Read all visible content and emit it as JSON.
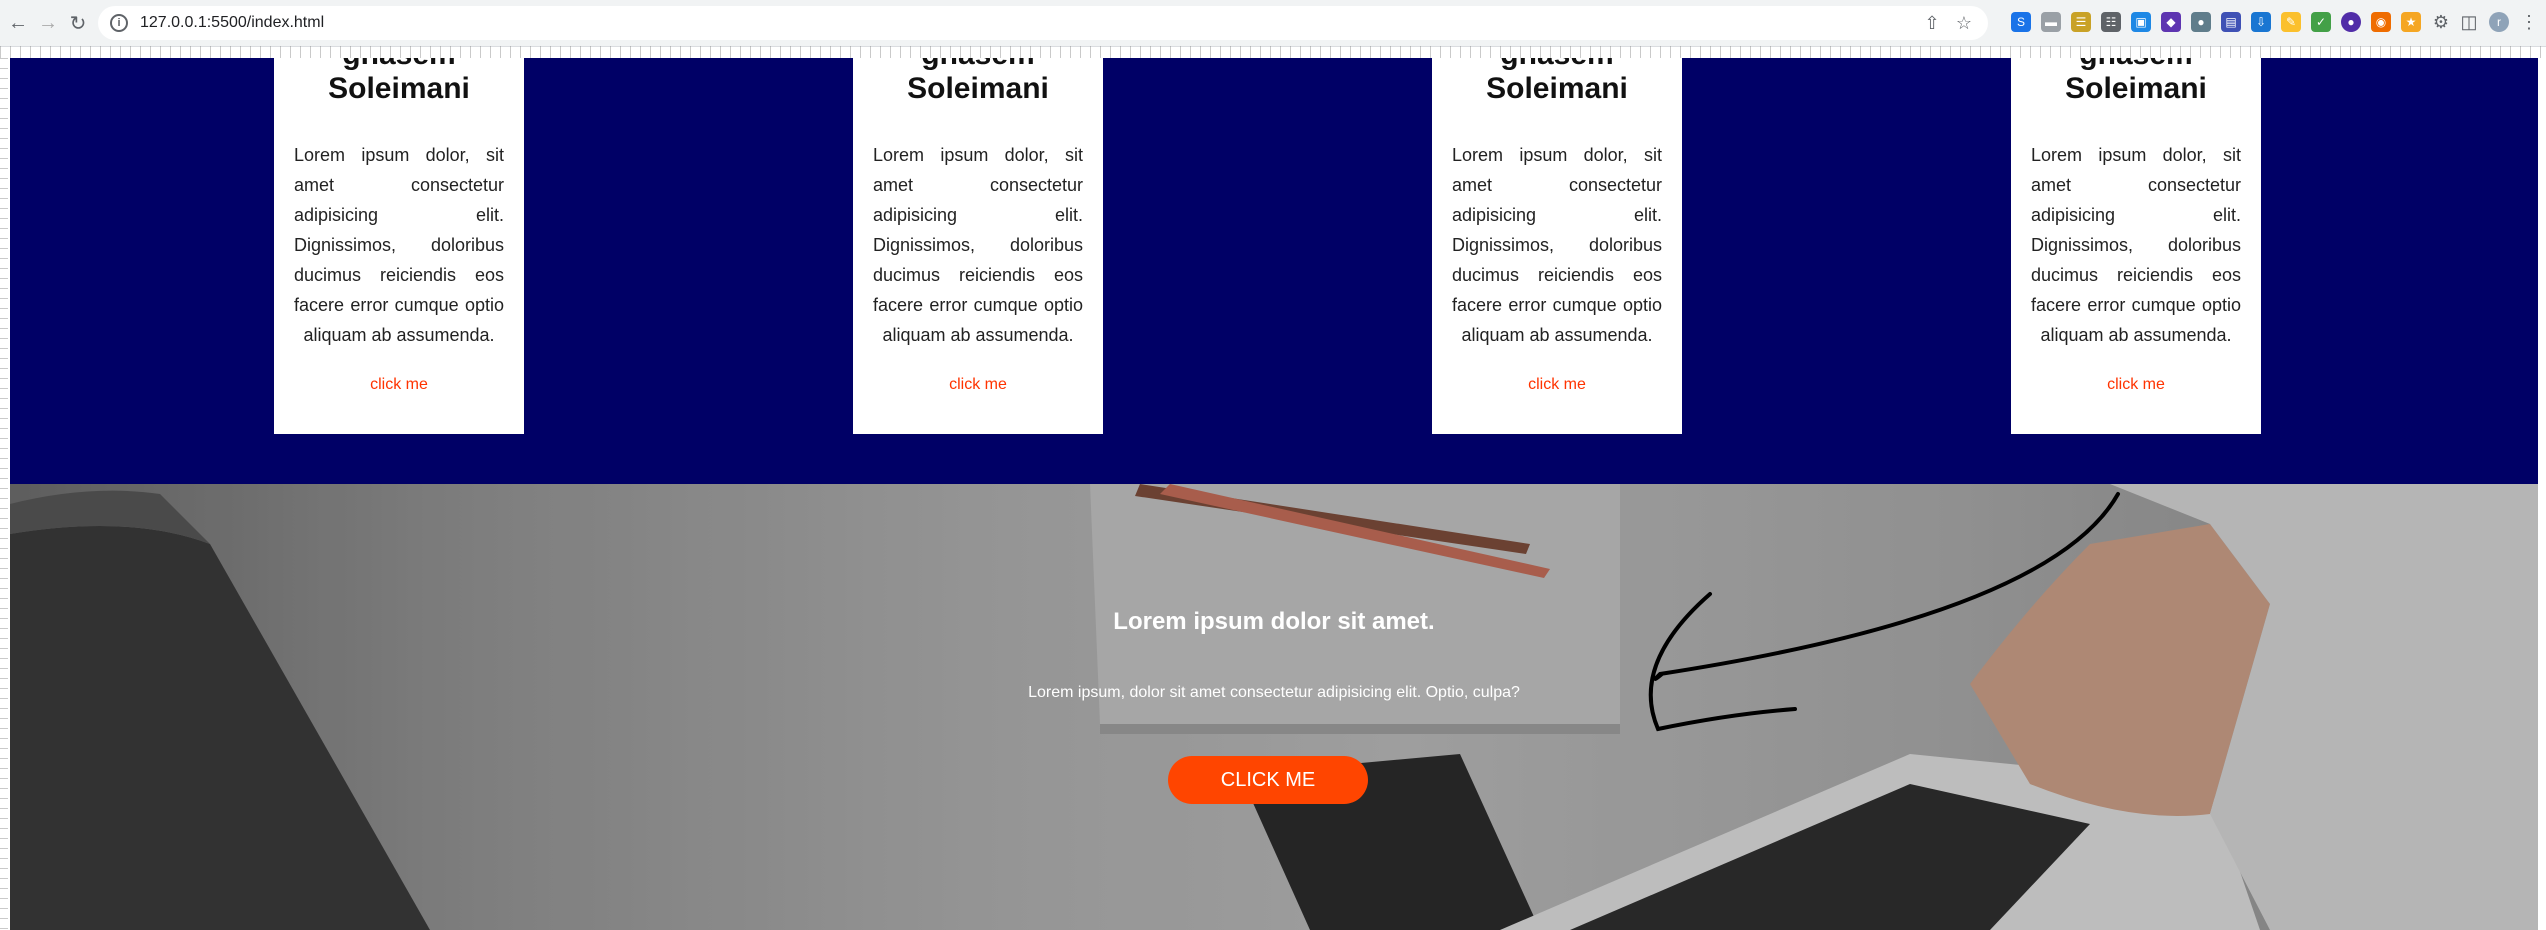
{
  "browser": {
    "url": "127.0.0.1:5500/index.html",
    "icons": [
      "back-icon",
      "forward-icon",
      "reload-icon",
      "site-info-icon",
      "share-icon",
      "bookmark-star-icon",
      "extensions-puzzle-icon",
      "profile-avatar-icon",
      "menu-dots-icon"
    ]
  },
  "cards": [
    {
      "title_line1": "ghasem",
      "title_line2": "Soleimani",
      "text": "Lorem ipsum dolor, sit amet consectetur adipisicing elit. Dignissimos, doloribus ducimus reiciendis eos facere error cumque optio aliquam ab assumenda.",
      "link": "click me"
    },
    {
      "title_line1": "ghasem",
      "title_line2": "Soleimani",
      "text": "Lorem ipsum dolor, sit amet consectetur adipisicing elit. Dignissimos, doloribus ducimus reiciendis eos facere error cumque optio aliquam ab assumenda.",
      "link": "click me"
    },
    {
      "title_line1": "ghasem",
      "title_line2": "Soleimani",
      "text": "Lorem ipsum dolor, sit amet consectetur adipisicing elit. Dignissimos, doloribus ducimus reiciendis eos facere error cumque optio aliquam ab assumenda.",
      "link": "click me"
    },
    {
      "title_line1": "ghasem",
      "title_line2": "Soleimani",
      "text": "Lorem ipsum dolor, sit amet consectetur adipisicing elit. Dignissimos, doloribus ducimus reiciendis eos facere error cumque optio aliquam ab assumenda.",
      "link": "click me"
    }
  ],
  "hero": {
    "title": "Lorem ipsum dolor sit amet.",
    "subtitle": "Lorem ipsum, dolor sit amet consectetur adipisicing elit. Optio, culpa?",
    "button": "CLICK ME"
  },
  "colors": {
    "section_bg": "#000066",
    "accent": "#ff4500",
    "link": "#ff3300",
    "card_bg": "#ffffff"
  }
}
